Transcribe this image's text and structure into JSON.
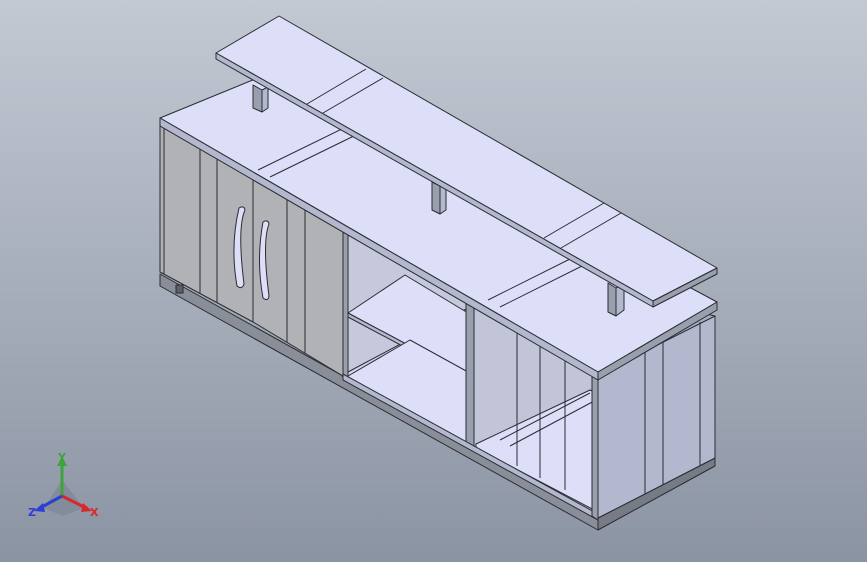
{
  "viewport": {
    "background_top": "#c3c9d3",
    "background_bottom": "#8b94a3",
    "model": "tv-cabinet-with-top-shelf"
  },
  "colors": {
    "face_light": "#dcdff7",
    "face_mid": "#b4b8ce",
    "face_dark": "#9a9fae",
    "door": "#b1b2b5",
    "edge": "#2a2c33"
  },
  "triad": {
    "x_label": "X",
    "y_label": "Y",
    "z_label": "Z",
    "x_color": "#d8282a",
    "y_color": "#3ca43c",
    "z_color": "#2c3fd4"
  }
}
